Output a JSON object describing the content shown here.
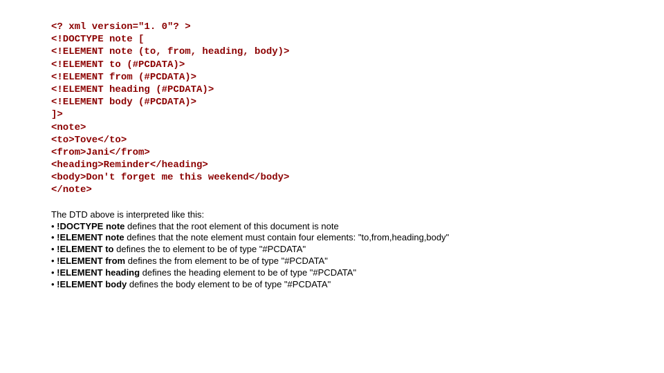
{
  "code": {
    "l1": "<? xml version=\"1. 0\"? >",
    "l2": "<!DOCTYPE note [",
    "l3": "<!ELEMENT note (to, from, heading, body)>",
    "l4": "<!ELEMENT to (#PCDATA)>",
    "l5": "<!ELEMENT from (#PCDATA)>",
    "l6": "<!ELEMENT heading (#PCDATA)>",
    "l7": "<!ELEMENT body (#PCDATA)>",
    "l8": "]>",
    "l9": "<note>",
    "l10": "<to>Tove</to>",
    "l11": "<from>Jani</from>",
    "l12": "<heading>Reminder</heading>",
    "l13": "<body>Don't forget me this weekend</body>",
    "l14": "</note>"
  },
  "explain": {
    "intro": "The DTD above is interpreted like this:",
    "b1_pre": "• ",
    "b1_bold": "!DOCTYPE note",
    "b1_post": " defines that the root element of this document is note",
    "b2_pre": "• ",
    "b2_bold": "!ELEMENT note",
    "b2_post": " defines that the note element must contain four elements: \"to,from,heading,body\"",
    "b3_pre": "• ",
    "b3_bold": "!ELEMENT to",
    "b3_post": " defines the to element to be of type \"#PCDATA\"",
    "b4_pre": "• ",
    "b4_bold": "!ELEMENT from",
    "b4_post": " defines the from element to be of type \"#PCDATA\"",
    "b5_pre": "• ",
    "b5_bold": "!ELEMENT heading",
    "b5_post": " defines the heading element to be of type \"#PCDATA\"",
    "b6_pre": "• ",
    "b6_bold": "!ELEMENT body",
    "b6_post": " defines the body element to be of type \"#PCDATA\""
  }
}
